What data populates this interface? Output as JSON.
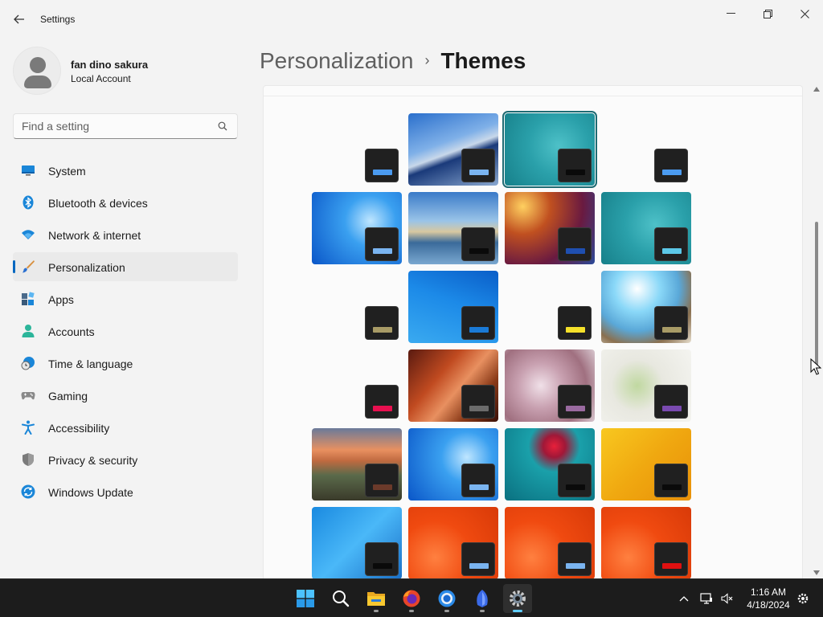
{
  "app": {
    "title": "Settings"
  },
  "user": {
    "name": "fan dino sakura",
    "account_type": "Local Account"
  },
  "search": {
    "placeholder": "Find a setting"
  },
  "nav": {
    "items": [
      {
        "label": "System",
        "icon": "monitor-icon"
      },
      {
        "label": "Bluetooth & devices",
        "icon": "bluetooth-icon"
      },
      {
        "label": "Network & internet",
        "icon": "wifi-icon"
      },
      {
        "label": "Personalization",
        "icon": "brush-icon",
        "active": true
      },
      {
        "label": "Apps",
        "icon": "apps-icon"
      },
      {
        "label": "Accounts",
        "icon": "person-icon"
      },
      {
        "label": "Time & language",
        "icon": "globe-clock-icon"
      },
      {
        "label": "Gaming",
        "icon": "gamepad-icon"
      },
      {
        "label": "Accessibility",
        "icon": "accessibility-icon"
      },
      {
        "label": "Privacy & security",
        "icon": "shield-icon"
      },
      {
        "label": "Windows Update",
        "icon": "update-icon"
      }
    ]
  },
  "breadcrumb": {
    "parent": "Personalization",
    "separator": "›",
    "current": "Themes"
  },
  "themes": {
    "selected_row": 0,
    "selected_col": 2,
    "accent_colors": {
      "blue": "#4b9bf0",
      "light_blue": "#7ab4f0",
      "black": "#0a0a0a",
      "dark_blue": "#1f4fb0",
      "cyan": "#5cc8e8",
      "khaki": "#a89b66",
      "mid_blue": "#1a7ad6",
      "yellow": "#f5e12a",
      "red_pink": "#e81050",
      "gray": "#6b6b6b",
      "mauve": "#9a6aa0",
      "purple": "#7a4ab0",
      "brown": "#6b3a2a",
      "red": "#e01010"
    }
  },
  "taskbar": {
    "apps": [
      "start-icon",
      "search-icon",
      "file-explorer-icon",
      "firefox-icon",
      "chrome-icon",
      "feather-app-icon",
      "settings-icon"
    ],
    "time": "1:16 AM",
    "date": "4/18/2024"
  }
}
